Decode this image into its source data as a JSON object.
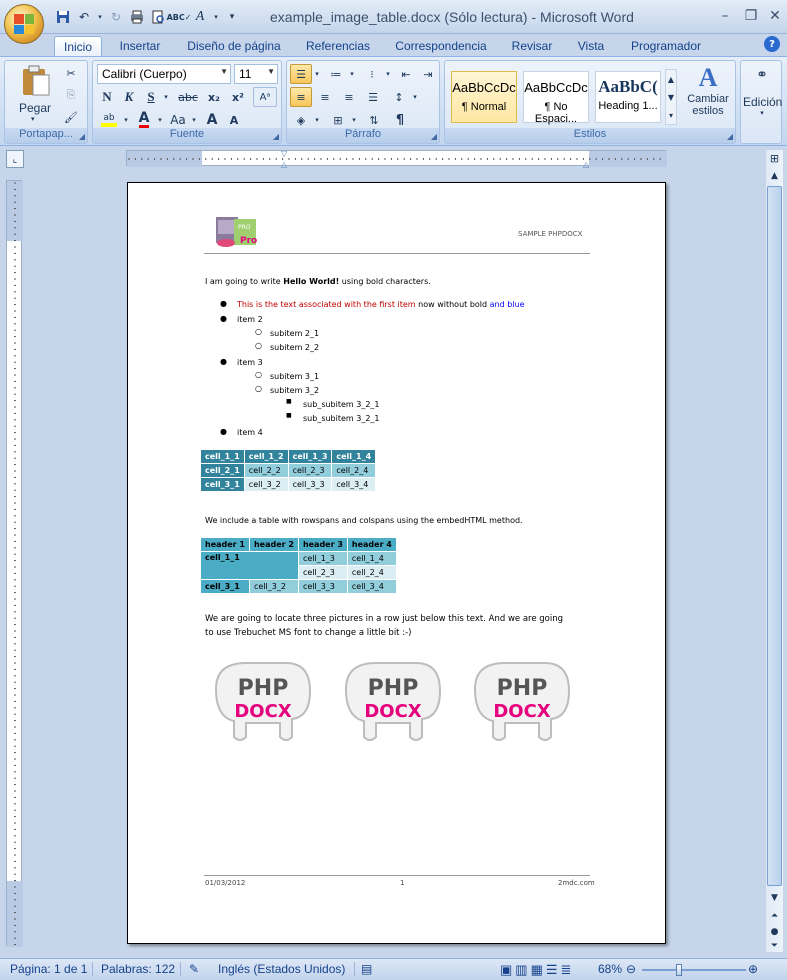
{
  "window": {
    "title": "example_image_table.docx (Sólo lectura) - Microsoft Word"
  },
  "qat": {
    "icons": [
      "save-icon",
      "undo-icon",
      "redo-icon",
      "print-icon",
      "print-preview-icon",
      "spelling-icon",
      "text-style-icon",
      "customize-icon"
    ]
  },
  "tabs": [
    {
      "label": "Inicio",
      "active": true
    },
    {
      "label": "Insertar"
    },
    {
      "label": "Diseño de página"
    },
    {
      "label": "Referencias"
    },
    {
      "label": "Correspondencia"
    },
    {
      "label": "Revisar"
    },
    {
      "label": "Vista"
    },
    {
      "label": "Programador"
    }
  ],
  "ribbon": {
    "clipboard": {
      "label": "Portapap...",
      "paste": "Pegar"
    },
    "font": {
      "label": "Fuente",
      "name": "Calibri (Cuerpo)",
      "size": "11",
      "bold": "N",
      "italic": "K",
      "underline": "S",
      "strike": "abc",
      "sub": "x₂",
      "sup": "x²",
      "grow": "A",
      "shrink": "A",
      "case": "Aa"
    },
    "paragraph": {
      "label": "Párrafo"
    },
    "styles": {
      "label": "Estilos",
      "items": [
        {
          "preview": "AaBbCcDc",
          "name": "¶ Normal"
        },
        {
          "preview": "AaBbCcDc",
          "name": "¶ No Espaci..."
        },
        {
          "preview": "AaBbC(",
          "name": "Heading 1..."
        }
      ],
      "change": "Cambiar estilos"
    },
    "editing": {
      "label": "Edición"
    }
  },
  "doc": {
    "header": "SAMPLE PHPDOCX",
    "intro_pre": "I am going to write ",
    "intro_bold": "Hello World!",
    "intro_post": " using bold  characters.",
    "item1_red": "This is the text associated with the first item",
    "item1_mid": " now without  bold ",
    "item1_blue": " and blue",
    "item2": "item 2",
    "sub21": "subitem 2_1",
    "sub22": "subitem 2_2",
    "item3": "item 3",
    "sub31": "subitem 3_1",
    "sub32": "subitem 3_2",
    "subsub1": "sub_subitem 3_2_1",
    "subsub2": "sub_subitem 3_2_1",
    "item4": "item 4",
    "table1": [
      [
        "cell_1_1",
        "cell_1_2",
        "cell_1_3",
        "cell_1_4"
      ],
      [
        "cell_2_1",
        "cell_2_2",
        "cell_2_3",
        "cell_2_4"
      ],
      [
        "cell_3_1",
        "cell_3_2",
        "cell_3_3",
        "cell_3_4"
      ]
    ],
    "para2": "We include a table with  rowspans and colspans using the embedHTML method.",
    "table2": {
      "header": [
        "header 1",
        "header 2",
        "header 3",
        "header 4"
      ],
      "c11": "cell_1_1",
      "c13": "cell_1_3",
      "c14": "cell_1_4",
      "c23": "cell_2_3",
      "c24": "cell_2_4",
      "r3": [
        "cell_3_1",
        "cell_3_2",
        "cell_3_3",
        "cell_3_4"
      ]
    },
    "para3a": "We are going to locate  three pictures in a row just below this text. And we are going",
    "para3b": "to use Trebuchet MS font to change a little bit :-)",
    "pic_label1": "PHP",
    "pic_label2": "DOCX",
    "footer": {
      "date": "01/03/2012",
      "page": "1",
      "site": "2mdc.com"
    }
  },
  "status": {
    "page": "Página: 1 de 1",
    "words": "Palabras: 122",
    "lang": "Inglés (Estados Unidos)",
    "zoom": "68%"
  },
  "colors": {
    "accent": "#4bacc6",
    "dark": "#31849b",
    "mid": "#92cddc",
    "light": "#daeef3",
    "red": "#c00000",
    "blue": "#0000ff",
    "pink": "#e5007e"
  }
}
